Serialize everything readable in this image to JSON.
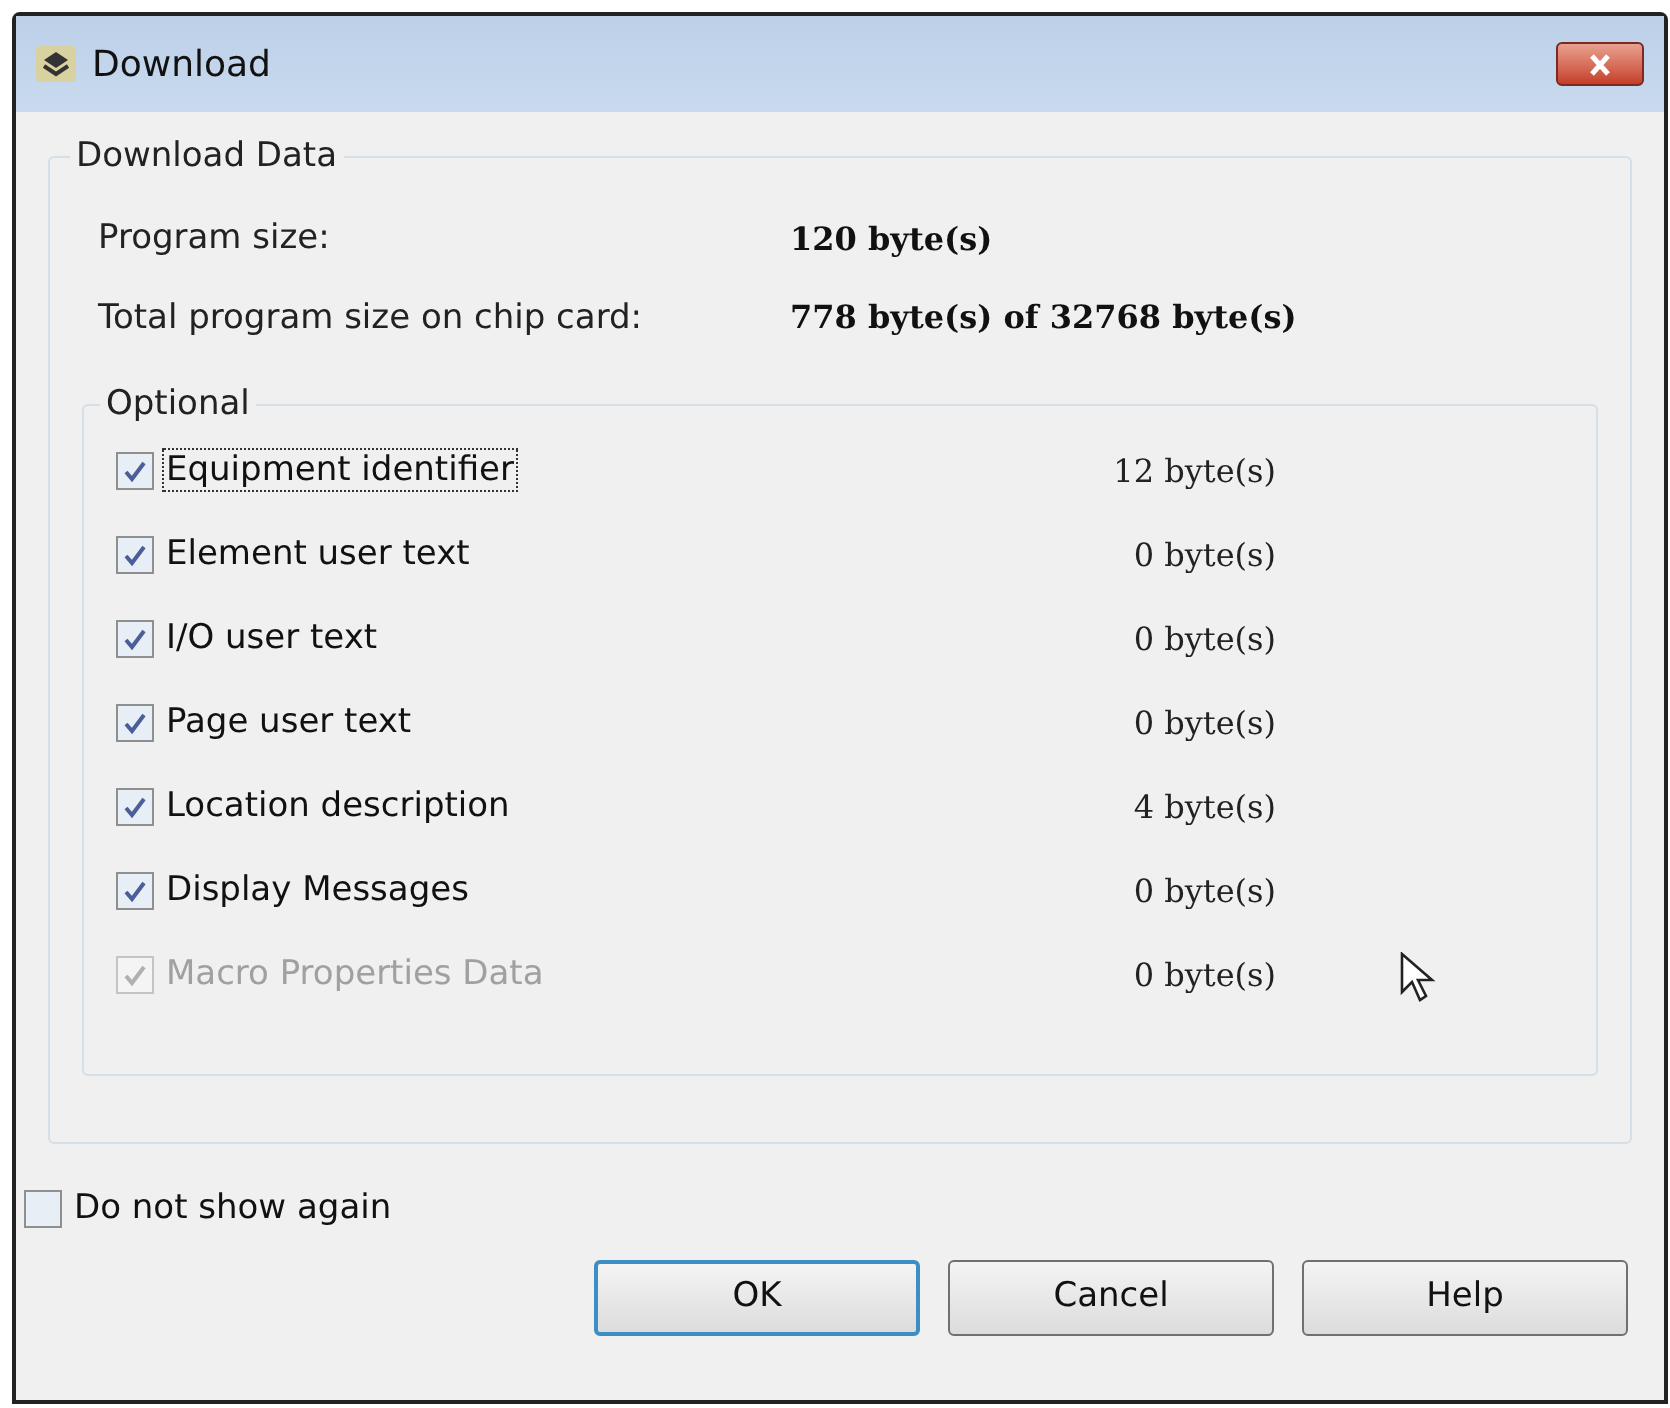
{
  "window": {
    "title": "Download"
  },
  "download_data": {
    "title": "Download Data",
    "info": [
      {
        "label": "Program size:",
        "value": "120 byte(s)"
      },
      {
        "label": "Total program size on chip card:",
        "value": "778 byte(s) of 32768 byte(s)"
      }
    ],
    "optional": {
      "title": "Optional",
      "items": [
        {
          "label": "Equipment identifier",
          "size": "12 byte(s)",
          "checked": true,
          "disabled": false,
          "focused": true
        },
        {
          "label": "Element user text",
          "size": "0 byte(s)",
          "checked": true,
          "disabled": false,
          "focused": false
        },
        {
          "label": "I/O user text",
          "size": "0 byte(s)",
          "checked": true,
          "disabled": false,
          "focused": false
        },
        {
          "label": "Page user text",
          "size": "0 byte(s)",
          "checked": true,
          "disabled": false,
          "focused": false
        },
        {
          "label": "Location description",
          "size": "4 byte(s)",
          "checked": true,
          "disabled": false,
          "focused": false
        },
        {
          "label": "Display Messages",
          "size": "0 byte(s)",
          "checked": true,
          "disabled": false,
          "focused": false
        },
        {
          "label": "Macro Properties Data",
          "size": "0 byte(s)",
          "checked": true,
          "disabled": true,
          "focused": false
        }
      ]
    }
  },
  "do_not_show": {
    "label": "Do not show again",
    "checked": false
  },
  "buttons": [
    {
      "label": "OK",
      "default": true
    },
    {
      "label": "Cancel",
      "default": false
    },
    {
      "label": "Help",
      "default": false
    }
  ]
}
